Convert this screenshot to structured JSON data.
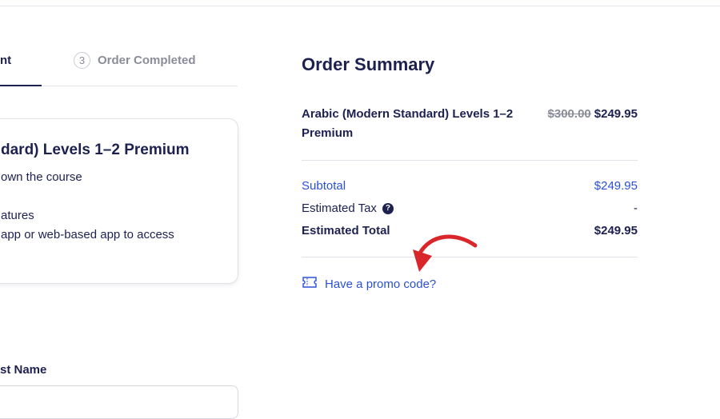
{
  "steps": {
    "active_label_fragment": "nt",
    "step3_number": "3",
    "step3_label": "Order Completed"
  },
  "card": {
    "title_fragment": "dard) Levels 1–2 Premium",
    "line1": "own the course",
    "line2": "atures",
    "line3": "app or web-based app to access"
  },
  "form": {
    "last_name_label_fragment": "st Name"
  },
  "summary": {
    "title": "Order Summary",
    "item_name": "Arabic (Modern Standard) Levels 1–2 Premium",
    "item_old_price": "$300.00",
    "item_new_price": "$249.95",
    "subtotal_label": "Subtotal",
    "subtotal_value": "$249.95",
    "tax_label": "Estimated Tax",
    "tax_help_glyph": "?",
    "tax_value": "-",
    "total_label": "Estimated Total",
    "total_value": "$249.95",
    "promo_label": "Have a promo code?"
  },
  "colors": {
    "navy": "#1d2150",
    "link_blue": "#2b50d6",
    "muted_gray": "#8a8d99",
    "annotation_red": "#d8262b"
  },
  "icons": {
    "promo": "ticket-icon",
    "tax_help": "question-circle-icon",
    "annotation": "curved-arrow-icon"
  }
}
